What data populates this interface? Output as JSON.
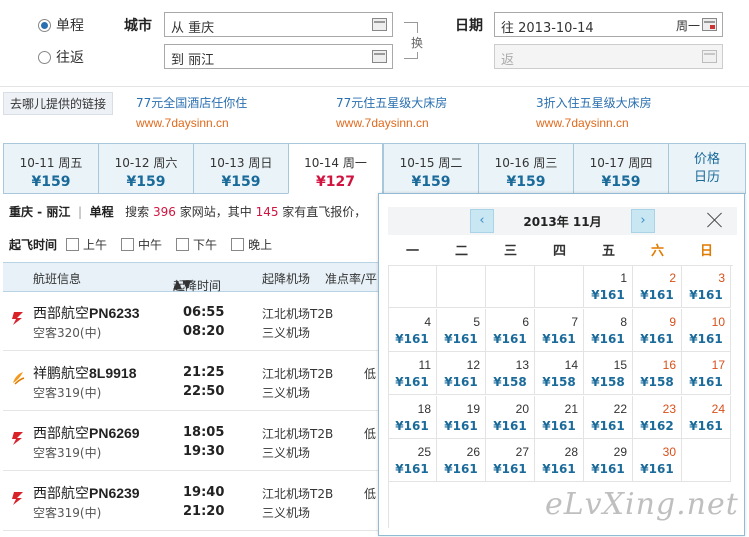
{
  "trip": {
    "oneway_label": "单程",
    "roundtrip_label": "往返",
    "city_label": "城市",
    "date_label": "日期",
    "from_value": "从 重庆",
    "to_value": "到 丽江",
    "depart_value": "往 2013-10-14",
    "depart_week": "周一",
    "return_placeholder": "返",
    "swap_label": "换"
  },
  "ads": {
    "tag": "去哪儿提供的链接",
    "items": [
      {
        "title": "77元全国酒店任你住",
        "url": "www.7daysinn.cn"
      },
      {
        "title": "77元住五星级大床房",
        "url": "www.7daysinn.cn"
      },
      {
        "title": "3折入住五星级大床房",
        "url": "www.7daysinn.cn"
      }
    ]
  },
  "tabs": [
    {
      "date": "10-11 周五",
      "price": "¥159"
    },
    {
      "date": "10-12 周六",
      "price": "¥159"
    },
    {
      "date": "10-13 周日",
      "price": "¥159"
    },
    {
      "date": "10-14 周一",
      "price": "¥127",
      "selected": true
    },
    {
      "date": "10-15 周二",
      "price": "¥159"
    },
    {
      "date": "10-16 周三",
      "price": "¥159"
    },
    {
      "date": "10-17 周四",
      "price": "¥159"
    }
  ],
  "calendar_tab": {
    "line1": "价格",
    "line2": "日历"
  },
  "summary": {
    "route": "重庆 - 丽江",
    "sep": "|",
    "type": "单程",
    "text1": "搜索",
    "sites": "396",
    "text2": "家网站，其中",
    "direct": "145",
    "text3": "家有直飞报价，"
  },
  "filters": {
    "label": "起飞时间",
    "options": [
      "上午",
      "中午",
      "下午",
      "晚上"
    ]
  },
  "list_header": {
    "flight": "航班信息",
    "time": "起降时间",
    "airport": "起降机场",
    "rate": "准点率/平"
  },
  "flights": [
    {
      "airline": "西部航空",
      "code": "PN6233",
      "plane": "空客320(中)",
      "dep": "06:55",
      "arr": "08:20",
      "from": "江北机场T2B",
      "to": "三义机场",
      "extra": "",
      "color": "#d8232a"
    },
    {
      "airline": "祥鹏航空",
      "code": "8L9918",
      "plane": "空客319(中)",
      "dep": "21:25",
      "arr": "22:50",
      "from": "江北机场T2B",
      "to": "三义机场",
      "extra": "低",
      "color": "#f29a1f"
    },
    {
      "airline": "西部航空",
      "code": "PN6269",
      "plane": "空客319(中)",
      "dep": "18:05",
      "arr": "19:30",
      "from": "江北机场T2B",
      "to": "三义机场",
      "extra": "低",
      "color": "#d8232a"
    },
    {
      "airline": "西部航空",
      "code": "PN6239",
      "plane": "空客319(中)",
      "dep": "19:40",
      "arr": "21:20",
      "from": "江北机场T2B",
      "to": "三义机场",
      "extra": "低",
      "color": "#d8232a"
    }
  ],
  "calendar": {
    "month": "2013年 11月",
    "prev": "‹",
    "next": "›",
    "weekdays": [
      "一",
      "二",
      "三",
      "四",
      "五",
      "六",
      "日"
    ],
    "first_weekday": 4,
    "days": [
      {
        "d": "1",
        "p": "¥161"
      },
      {
        "d": "2",
        "p": "¥161"
      },
      {
        "d": "3",
        "p": "¥161"
      },
      {
        "d": "4",
        "p": "¥161"
      },
      {
        "d": "5",
        "p": "¥161"
      },
      {
        "d": "6",
        "p": "¥161"
      },
      {
        "d": "7",
        "p": "¥161"
      },
      {
        "d": "8",
        "p": "¥161"
      },
      {
        "d": "9",
        "p": "¥161"
      },
      {
        "d": "10",
        "p": "¥161"
      },
      {
        "d": "11",
        "p": "¥161"
      },
      {
        "d": "12",
        "p": "¥161"
      },
      {
        "d": "13",
        "p": "¥158"
      },
      {
        "d": "14",
        "p": "¥158"
      },
      {
        "d": "15",
        "p": "¥158"
      },
      {
        "d": "16",
        "p": "¥158"
      },
      {
        "d": "17",
        "p": "¥161"
      },
      {
        "d": "18",
        "p": "¥161"
      },
      {
        "d": "19",
        "p": "¥161"
      },
      {
        "d": "20",
        "p": "¥161"
      },
      {
        "d": "21",
        "p": "¥161"
      },
      {
        "d": "22",
        "p": "¥161"
      },
      {
        "d": "23",
        "p": "¥162"
      },
      {
        "d": "24",
        "p": "¥161"
      },
      {
        "d": "25",
        "p": "¥161"
      },
      {
        "d": "26",
        "p": "¥161"
      },
      {
        "d": "27",
        "p": "¥161"
      },
      {
        "d": "28",
        "p": "¥161"
      },
      {
        "d": "29",
        "p": "¥161"
      },
      {
        "d": "30",
        "p": "¥161"
      }
    ]
  },
  "watermark": "eLvXing.net"
}
